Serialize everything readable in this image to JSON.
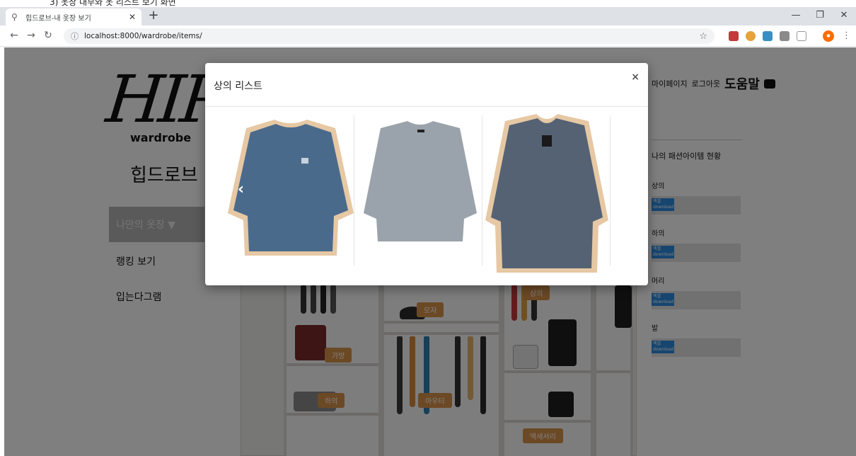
{
  "document_caption": "3)   옷장 내부와 옷 리스트 보기 화면",
  "browser": {
    "tab_title": "힙드로브-내 옷장 보기",
    "url": "localhost:8000/wardrobe/items/"
  },
  "site": {
    "logo": "HIP",
    "wordmark": "wardrobe",
    "korean_name": "힙드로브"
  },
  "sidebar": {
    "items": [
      {
        "label": "나만의 옷장 ▼"
      },
      {
        "label": "랭킹 보기"
      },
      {
        "label": "입는다그램"
      }
    ]
  },
  "top_nav": {
    "links": [
      "마이페이지",
      "로그아웃"
    ],
    "help": "도움말"
  },
  "stats": {
    "title": "나의 패션아이템 현황",
    "categories": [
      {
        "label": "상의",
        "button": "엑셀 download"
      },
      {
        "label": "하의",
        "button": "엑셀 download"
      },
      {
        "label": "머리",
        "button": "엑셀 download"
      },
      {
        "label": "발",
        "button": "엑셀 download"
      }
    ]
  },
  "closet": {
    "labels": {
      "top": "상의",
      "hat": "모자",
      "bag": "가방",
      "bottom": "하의",
      "outer": "아우터",
      "accessory": "액세서리"
    }
  },
  "modal": {
    "title": "상의 리스트",
    "close": "×",
    "prev": "‹",
    "items": [
      {
        "name": "navy sweatshirt",
        "color": "#4a6a8c"
      },
      {
        "name": "grey sweatshirt",
        "color": "#9aa3ab"
      },
      {
        "name": "knit cardigan",
        "color": "#556273"
      }
    ]
  },
  "colors": {
    "sidebar_active": "#b4b4b4",
    "download_button": "#2d8be0",
    "closet_label": "#d9924b",
    "sweater_frame": "#e6c8a4"
  }
}
